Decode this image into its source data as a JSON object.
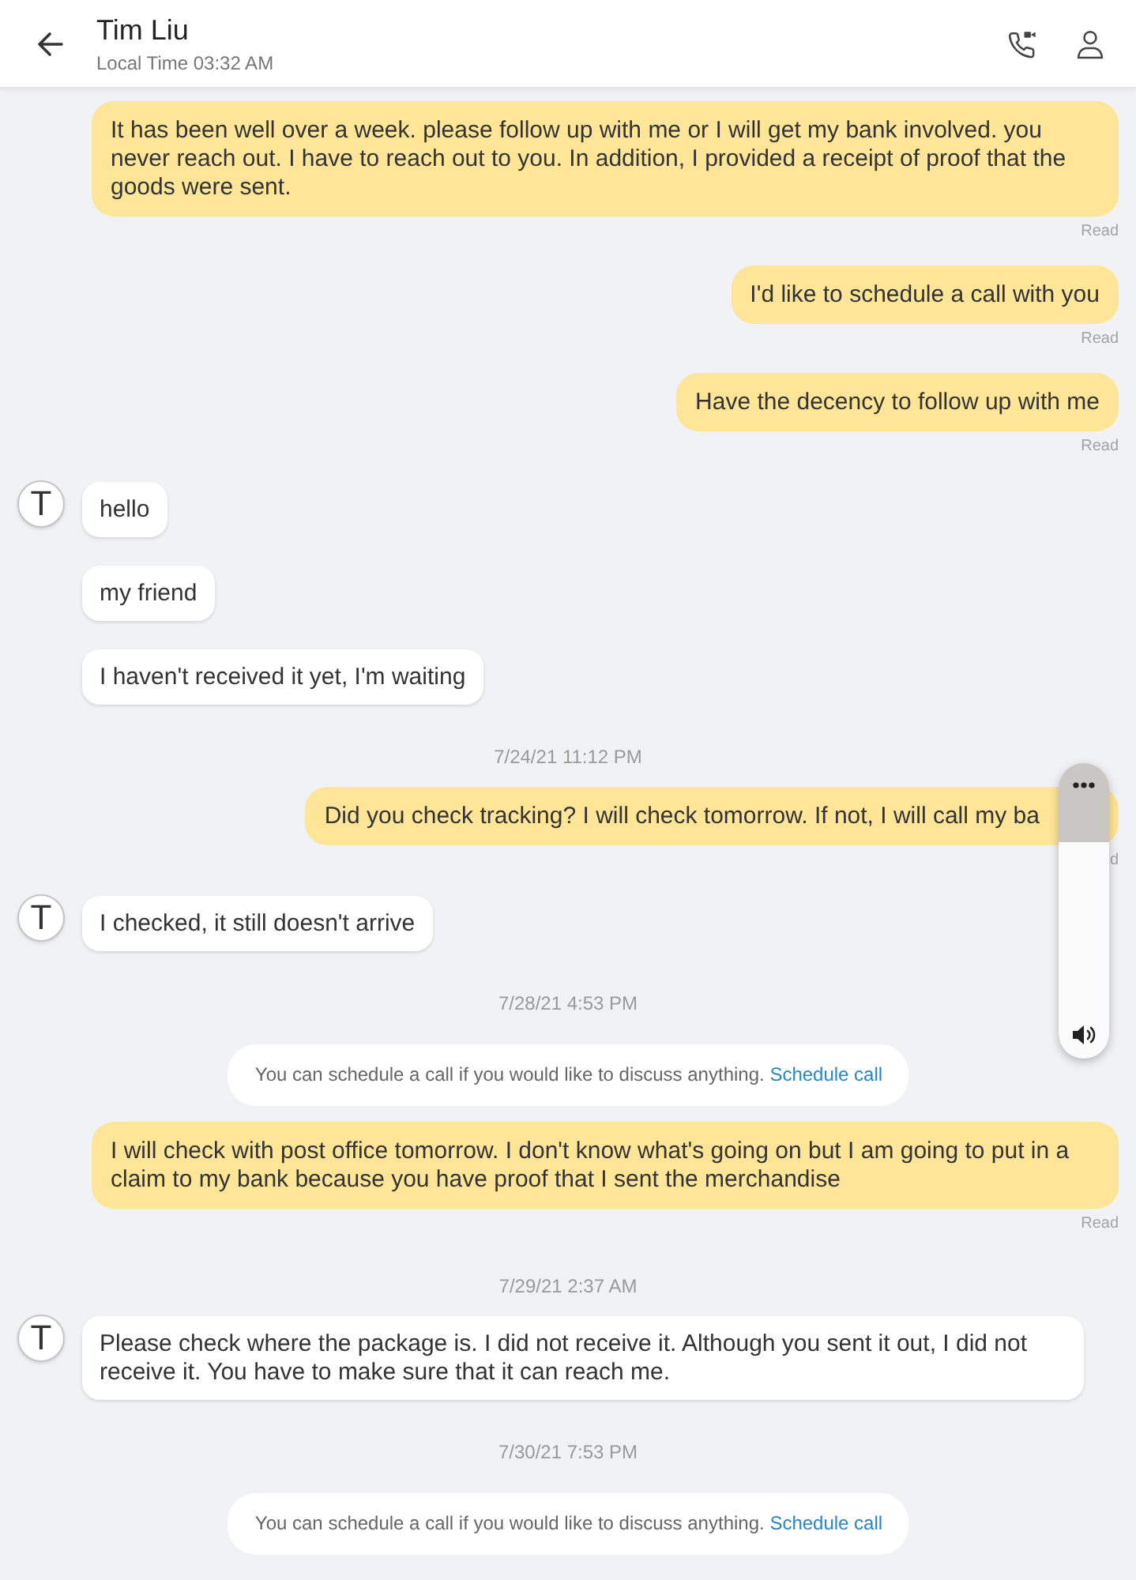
{
  "header": {
    "title": "Tim Liu",
    "subtitle": "Local Time 03:32 AM"
  },
  "messages": [
    {
      "kind": "outgoing",
      "text": "It has been well over a week. please follow up with me or I will get my bank involved. you never reach out. I have to reach out to you. In addition, I provided a receipt of proof that the goods were sent.",
      "status": "Read",
      "covered": false
    },
    {
      "kind": "outgoing",
      "text": "I'd like to schedule a call with you",
      "status": "Read",
      "covered": false
    },
    {
      "kind": "outgoing",
      "text": "Have the decency to follow up with me",
      "status": "Read",
      "covered": false
    },
    {
      "kind": "incoming",
      "avatar": "T",
      "text": "hello"
    },
    {
      "kind": "incoming",
      "text": "my friend"
    },
    {
      "kind": "incoming",
      "text": "I haven't received it yet, I'm waiting"
    },
    {
      "kind": "timestamp",
      "text": "7/24/21 11:12 PM"
    },
    {
      "kind": "outgoing",
      "text": "Did you check tracking? I will check tomorrow. If not, I will call my ba",
      "status": "d",
      "covered": true
    },
    {
      "kind": "incoming",
      "avatar": "T",
      "text": "I checked, it still doesn't arrive"
    },
    {
      "kind": "timestamp",
      "text": "7/28/21 4:53 PM"
    },
    {
      "kind": "notice",
      "text": "You can schedule a call if you would like to discuss anything.",
      "link": "Schedule call"
    },
    {
      "kind": "outgoing",
      "text": "I will check with post office tomorrow. I don't know what's going on but I am going to put in a claim to my bank because you have proof that I sent the merchandise",
      "status": "Read",
      "covered": false
    },
    {
      "kind": "timestamp",
      "text": "7/29/21 2:37 AM"
    },
    {
      "kind": "incoming",
      "avatar": "T",
      "text": "Please check where the package is. I did not receive it. Although you sent it out, I did not receive it. You have to make sure that it can reach me."
    },
    {
      "kind": "timestamp",
      "text": "7/30/21 7:53 PM"
    },
    {
      "kind": "notice",
      "text": "You can schedule a call if you would like to discuss anything.",
      "link": "Schedule call"
    }
  ],
  "volume_panel": {
    "shown": true
  }
}
